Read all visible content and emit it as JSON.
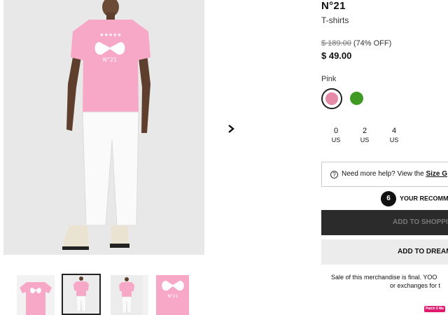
{
  "gallery": {
    "next_icon": "chevron-right-icon",
    "shirt_logo_text": "N°21"
  },
  "product": {
    "brand": "N°21",
    "category": "T-shirts",
    "price_original": "$ 189.00",
    "discount": "(74% OFF)",
    "price_current": "$ 49.00",
    "color_label": "Pink",
    "colors": [
      {
        "name": "pink",
        "hex": "#e58aa7",
        "selected": true
      },
      {
        "name": "green",
        "hex": "#3f9a24",
        "selected": false
      }
    ],
    "sizes": [
      {
        "num": "0",
        "unit": "US"
      },
      {
        "num": "2",
        "unit": "US"
      },
      {
        "num": "4",
        "unit": "US"
      }
    ]
  },
  "help": {
    "icon": "question-circle-icon",
    "text": "Need more help? View the ",
    "link": "Size G"
  },
  "recommendation": {
    "count": "6",
    "label": "YOUR RECOMM"
  },
  "buttons": {
    "add_to_shopping": "ADD TO SHOPPIN",
    "add_to_dream": "ADD TO DREAM"
  },
  "sale_note": {
    "line1": "Sale of this merchandise is final. YOO",
    "line2": "or exchanges for t"
  },
  "badge": {
    "label": "Patch 5 Me"
  }
}
